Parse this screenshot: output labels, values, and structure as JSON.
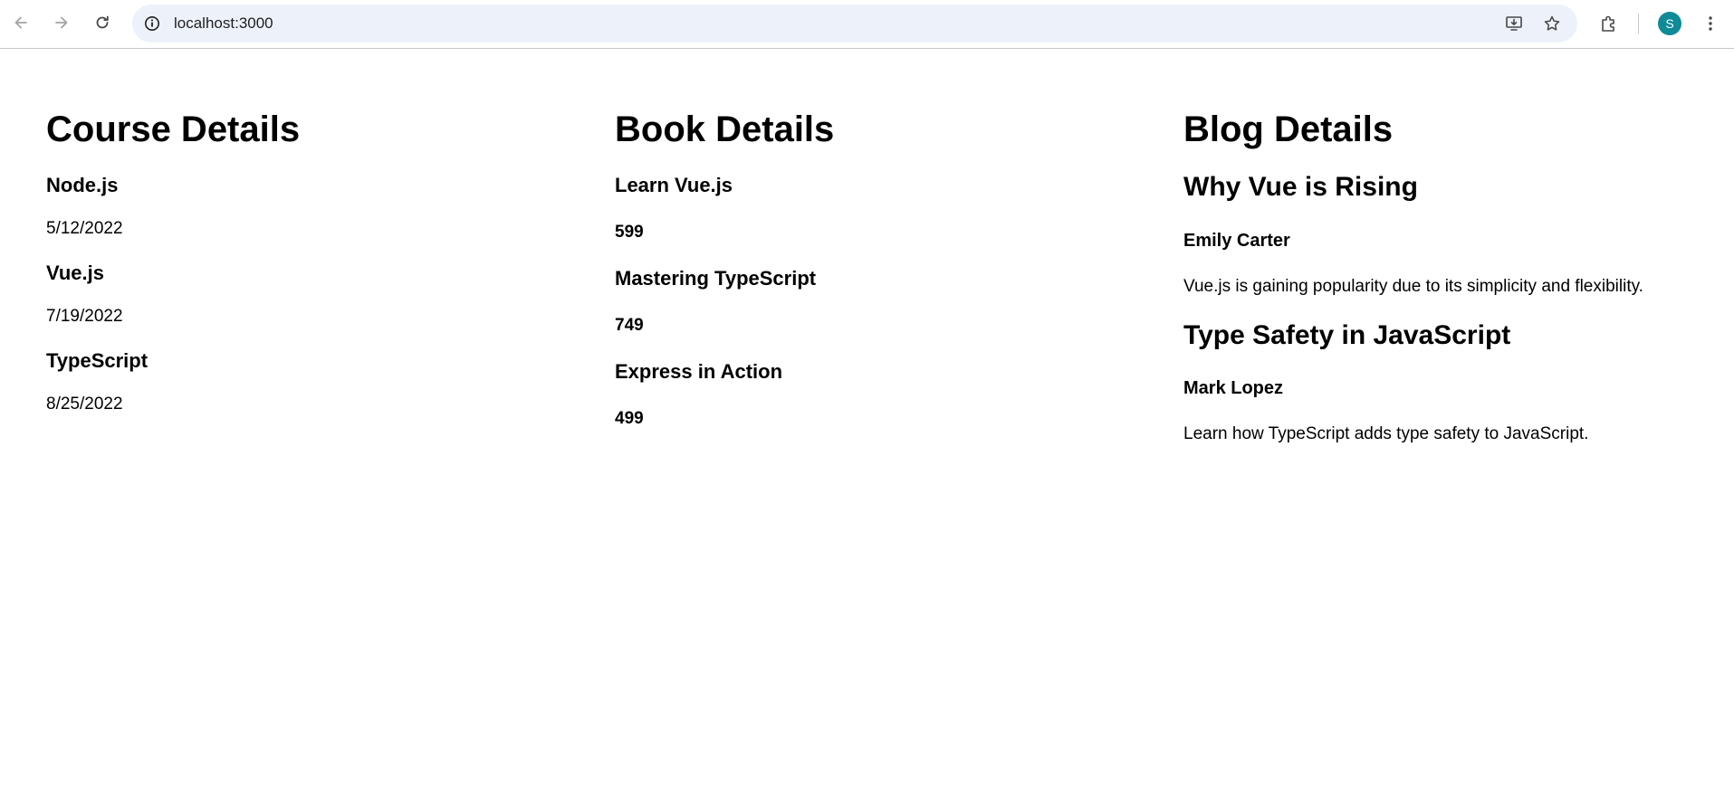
{
  "browser": {
    "url": "localhost:3000",
    "avatar_initial": "S",
    "avatar_color": "#0f8a97"
  },
  "courses": {
    "heading": "Course Details",
    "items": [
      {
        "name": "Node.js",
        "date": "5/12/2022"
      },
      {
        "name": "Vue.js",
        "date": "7/19/2022"
      },
      {
        "name": "TypeScript",
        "date": "8/25/2022"
      }
    ]
  },
  "books": {
    "heading": "Book Details",
    "items": [
      {
        "title": "Learn Vue.js",
        "price": "599"
      },
      {
        "title": "Mastering TypeScript",
        "price": "749"
      },
      {
        "title": "Express in Action",
        "price": "499"
      }
    ]
  },
  "blogs": {
    "heading": "Blog Details",
    "items": [
      {
        "title": "Why Vue is Rising",
        "author": "Emily Carter",
        "summary": "Vue.js is gaining popularity due to its simplicity and flexibility."
      },
      {
        "title": "Type Safety in JavaScript",
        "author": "Mark Lopez",
        "summary": "Learn how TypeScript adds type safety to JavaScript."
      }
    ]
  },
  "icons": {
    "back": "back-arrow-icon",
    "forward": "forward-arrow-icon",
    "reload": "reload-icon",
    "site_info": "site-info-icon",
    "install": "install-app-icon",
    "bookmark": "bookmark-star-icon",
    "extensions": "extensions-puzzle-icon",
    "menu": "more-vertical-icon"
  }
}
